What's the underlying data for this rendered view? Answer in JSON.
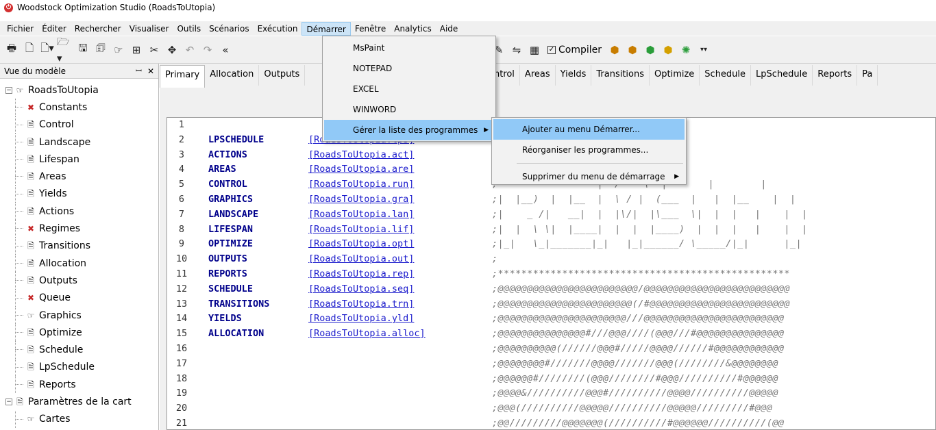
{
  "window": {
    "title": "Woodstock Optimization Studio  (RoadsToUtopia)"
  },
  "menubar": {
    "items": [
      "Fichier",
      "Éditer",
      "Rechercher",
      "Visualiser",
      "Outils",
      "Scénarios",
      "Exécution",
      "Démarrer",
      "Fenêtre",
      "Analytics",
      "Aide"
    ]
  },
  "toolbar": {
    "compile_label": "Compiler",
    "compile_checked": true
  },
  "model_panel": {
    "title": "Vue du modèle",
    "pin_glyph": "📌",
    "close_glyph": "✕",
    "root": "RoadsToUtopia",
    "items": [
      {
        "label": "Constants",
        "icon": "error-icon"
      },
      {
        "label": "Control",
        "icon": "document-icon"
      },
      {
        "label": "Landscape",
        "icon": "document-icon"
      },
      {
        "label": "Lifespan",
        "icon": "document-icon"
      },
      {
        "label": "Areas",
        "icon": "document-icon"
      },
      {
        "label": "Yields",
        "icon": "document-icon"
      },
      {
        "label": "Actions",
        "icon": "document-icon"
      },
      {
        "label": "Regimes",
        "icon": "error-icon"
      },
      {
        "label": "Transitions",
        "icon": "document-icon"
      },
      {
        "label": "Allocation",
        "icon": "document-icon"
      },
      {
        "label": "Outputs",
        "icon": "document-icon"
      },
      {
        "label": "Queue",
        "icon": "error-icon"
      },
      {
        "label": "Graphics",
        "icon": "graphics-icon"
      },
      {
        "label": "Optimize",
        "icon": "document-icon"
      },
      {
        "label": "Schedule",
        "icon": "document-icon"
      },
      {
        "label": "LpSchedule",
        "icon": "document-icon"
      },
      {
        "label": "Reports",
        "icon": "document-icon"
      }
    ],
    "map_params": "Paramètres de la cart",
    "map_child": "Cartes"
  },
  "tabs": {
    "left": [
      "Primary",
      "Allocation",
      "Outputs"
    ],
    "right": [
      "ontrol",
      "Areas",
      "Yields",
      "Transitions",
      "Optimize",
      "Schedule",
      "LpSchedule",
      "Reports",
      "Pa"
    ]
  },
  "editor": {
    "lines": [
      {
        "n": "1",
        "kw": "",
        "file": "",
        "cmt": ""
      },
      {
        "n": "2",
        "kw": "LPSCHEDULE",
        "file": "[RoadsToUtopia.lps]",
        "cmt": ""
      },
      {
        "n": "3",
        "kw": "ACTIONS",
        "file": "[RoadsToUtopia.act]",
        "cmt": "****************************"
      },
      {
        "n": "4",
        "kw": "AREAS",
        "file": "[RoadsToUtopia.are]",
        "cmt": ""
      },
      {
        "n": "5",
        "kw": "CONTROL",
        "file": "[RoadsToUtopia.run]",
        "cmt": ";                 |  /    \\  |       |        |"
      },
      {
        "n": "6",
        "kw": "GRAPHICS",
        "file": "[RoadsToUtopia.gra]",
        "cmt": ";|  |__)  |  |__  |  \\ / |  (___  |   |  |__    |  |"
      },
      {
        "n": "7",
        "kw": "LANDSCAPE",
        "file": "[RoadsToUtopia.lan]",
        "cmt": ";|    _ /|   __|  |  |\\/|  |\\___  \\|  |  |   |    |  |"
      },
      {
        "n": "8",
        "kw": "LIFESPAN",
        "file": "[RoadsToUtopia.lif]",
        "cmt": ";|  |  \\ \\|  |____|  |  |  |____)  |  |  |   |    |  |"
      },
      {
        "n": "9",
        "kw": "OPTIMIZE",
        "file": "[RoadsToUtopia.opt]",
        "cmt": ";|_|   \\_|_______|_|   |_|______/ \\_____/|_|      |_|"
      },
      {
        "n": "10",
        "kw": "OUTPUTS",
        "file": "[RoadsToUtopia.out]",
        "cmt": ";"
      },
      {
        "n": "11",
        "kw": "REPORTS",
        "file": "[RoadsToUtopia.rep]",
        "cmt": ";**************************************************"
      },
      {
        "n": "12",
        "kw": "SCHEDULE",
        "file": "[RoadsToUtopia.seq]",
        "cmt": ";@@@@@@@@@@@@@@@@@@@@@@@@/@@@@@@@@@@@@@@@@@@@@@@@@@"
      },
      {
        "n": "13",
        "kw": "TRANSITIONS",
        "file": "[RoadsToUtopia.trn]",
        "cmt": ";@@@@@@@@@@@@@@@@@@@@@@@(/#@@@@@@@@@@@@@@@@@@@@@@@@"
      },
      {
        "n": "14",
        "kw": "YIELDS",
        "file": "[RoadsToUtopia.yld]",
        "cmt": ";@@@@@@@@@@@@@@@@@@@@@@///@@@@@@@@@@@@@@@@@@@@@@@@"
      },
      {
        "n": "15",
        "kw": "ALLOCATION",
        "file": "[RoadsToUtopia.alloc]",
        "cmt": ";@@@@@@@@@@@@@@@#///@@@////(@@@///#@@@@@@@@@@@@@@@"
      },
      {
        "n": "16",
        "kw": "",
        "file": "",
        "cmt": ";@@@@@@@@@@(//////@@@#/////@@@@//////#@@@@@@@@@@@@"
      },
      {
        "n": "17",
        "kw": "",
        "file": "",
        "cmt": ";@@@@@@@@#///////@@@@///////@@@(////////&@@@@@@@@"
      },
      {
        "n": "18",
        "kw": "",
        "file": "",
        "cmt": ";@@@@@@#////////(@@@////////#@@@//////////#@@@@@@"
      },
      {
        "n": "19",
        "kw": "",
        "file": "",
        "cmt": ";@@@@&//////////@@@#//////////@@@@//////////@@@@@"
      },
      {
        "n": "20",
        "kw": "",
        "file": "",
        "cmt": ";@@@(//////////@@@@@//////////@@@@@/////////#@@@"
      },
      {
        "n": "21",
        "kw": "",
        "file": "",
        "cmt": ";@@/////////@@@@@@@(//////////#@@@@@@//////////(@@"
      }
    ]
  },
  "start_menu": {
    "items": [
      {
        "label": "MsPaint",
        "has_submenu": false
      },
      {
        "label": "NOTEPAD",
        "has_submenu": false
      },
      {
        "label": "EXCEL",
        "has_submenu": false
      },
      {
        "label": "WINWORD",
        "has_submenu": false
      },
      {
        "label": "Gérer la liste des programmes",
        "has_submenu": true
      }
    ],
    "submenu": {
      "items": [
        {
          "label": "Ajouter au menu Démarrer..."
        },
        {
          "label": "Réorganiser les programmes..."
        },
        {
          "label": "Supprimer du menu de démarrage",
          "has_submenu": true
        }
      ]
    },
    "highlight_color": "#91c9f7"
  }
}
